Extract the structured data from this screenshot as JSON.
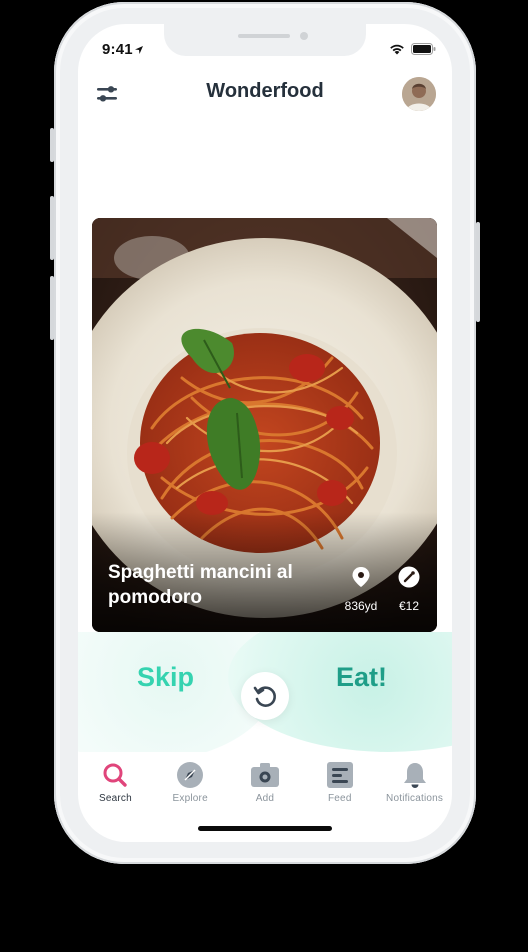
{
  "status_bar": {
    "time": "9:41",
    "icons": [
      "location-arrow-icon",
      "wifi-icon",
      "battery-icon"
    ]
  },
  "header": {
    "title": "Wonderfood",
    "left_icon": "filter-sliders-icon",
    "right_icon": "avatar"
  },
  "card": {
    "dish_name": "Spaghetti mancini al pomodoro",
    "distance": {
      "icon": "location-pin-icon",
      "label": "836yd"
    },
    "price": {
      "icon": "price-tag-icon",
      "label": "€12"
    }
  },
  "actions": {
    "skip_label": "Skip",
    "eat_label": "Eat!",
    "undo_icon": "undo-icon"
  },
  "tabs": [
    {
      "label": "Search",
      "icon": "search-icon",
      "active": true
    },
    {
      "label": "Explore",
      "icon": "compass-icon",
      "active": false
    },
    {
      "label": "Add",
      "icon": "camera-icon",
      "active": false
    },
    {
      "label": "Feed",
      "icon": "feed-icon",
      "active": false
    },
    {
      "label": "Notifications",
      "icon": "bell-icon",
      "active": false
    }
  ],
  "colors": {
    "accent": "#35d3b0",
    "accent_dark": "#1f9e88",
    "active_tab": "#e0457b",
    "title": "#25303b"
  }
}
